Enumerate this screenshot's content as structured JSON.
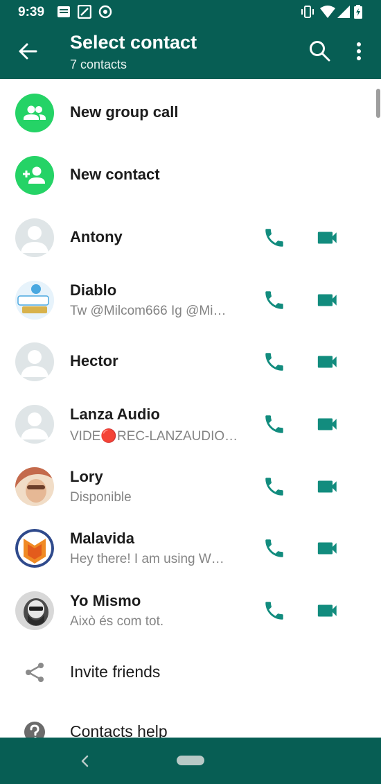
{
  "status_bar": {
    "time": "9:39",
    "left_icons": [
      "message-icon",
      "gallery-icon",
      "sync-icon"
    ],
    "right_icons": [
      "vibrate-icon",
      "wifi-icon",
      "signal-icon",
      "battery-icon"
    ]
  },
  "toolbar": {
    "title": "Select contact",
    "subtitle": "7 contacts",
    "back_icon": "arrow-back-icon",
    "actions": [
      "search-icon",
      "more-vert-icon"
    ]
  },
  "actions": [
    {
      "label": "New group call",
      "icon": "group-icon"
    },
    {
      "label": "New contact",
      "icon": "add-person-icon"
    }
  ],
  "contacts": [
    {
      "name": "Antony",
      "status": ""
    },
    {
      "name": "Diablo",
      "status": "Tw @Milcom666 Ig @Mi…"
    },
    {
      "name": "Hector",
      "status": ""
    },
    {
      "name": "Lanza Audio",
      "status": "VIDE🔴REC-LANZAUDIO…"
    },
    {
      "name": "Lory",
      "status": "Disponible"
    },
    {
      "name": "Malavida",
      "status": "Hey there! I am using W…"
    },
    {
      "name": "Yo Mismo",
      "status": "Això és com tot."
    }
  ],
  "footer_items": [
    {
      "label": "Invite friends",
      "icon": "share-icon"
    },
    {
      "label": "Contacts help",
      "icon": "help-icon"
    }
  ],
  "colors": {
    "header": "#075e54",
    "accent_green": "#25d366",
    "action_teal": "#128c7e"
  }
}
